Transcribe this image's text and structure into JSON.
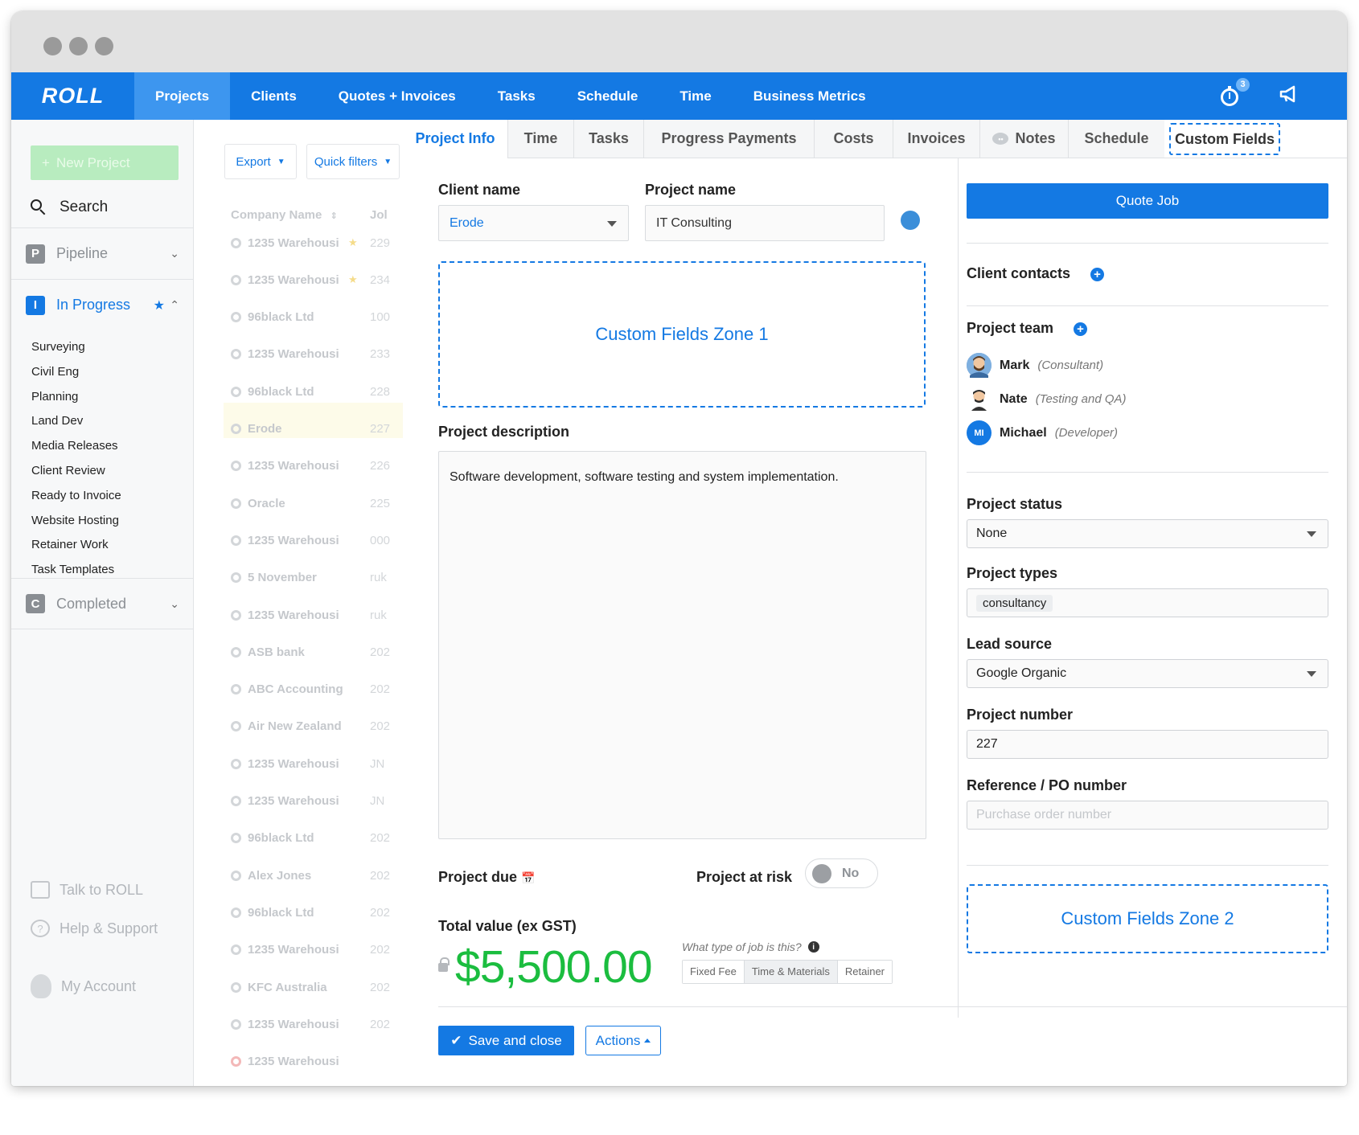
{
  "nav": {
    "logo": "ROLL",
    "items": [
      "Projects",
      "Clients",
      "Quotes + Invoices",
      "Tasks",
      "Schedule",
      "Time",
      "Business Metrics"
    ],
    "timer_badge": "3",
    "accent": "#1479e3"
  },
  "sidebar": {
    "new_project": "New Project",
    "search": "Search",
    "pipeline": {
      "letter": "P",
      "label": "Pipeline"
    },
    "in_progress": {
      "letter": "I",
      "label": "In Progress"
    },
    "sub_items": [
      "Surveying",
      "Civil Eng",
      "Planning",
      "Land Dev",
      "Media Releases",
      "Client Review",
      "Ready to Invoice",
      "Website Hosting",
      "Retainer Work",
      "Task Templates"
    ],
    "completed": {
      "letter": "C",
      "label": "Completed"
    },
    "footer": {
      "talk": "Talk to ROLL",
      "help": "Help & Support",
      "account": "My Account"
    }
  },
  "list": {
    "export": "Export",
    "quick_filters": "Quick filters",
    "col_company": "Company Name",
    "col_job": "Jol",
    "rows": [
      {
        "name": "1235 Warehousi",
        "num": "229",
        "star": true
      },
      {
        "name": "1235 Warehousi",
        "num": "234",
        "star": true
      },
      {
        "name": "96black Ltd",
        "num": "100"
      },
      {
        "name": "1235 Warehousi",
        "num": "233"
      },
      {
        "name": "96black Ltd",
        "num": "228"
      },
      {
        "name": "Erode",
        "num": "227"
      },
      {
        "name": "1235 Warehousi",
        "num": "226"
      },
      {
        "name": "Oracle",
        "num": "225"
      },
      {
        "name": "1235 Warehousi",
        "num": "000"
      },
      {
        "name": "5 November",
        "num": "ruk"
      },
      {
        "name": "1235 Warehousi",
        "num": "ruk"
      },
      {
        "name": "ASB bank",
        "num": "202"
      },
      {
        "name": "ABC Accounting",
        "num": "202"
      },
      {
        "name": "Air New Zealand",
        "num": "202"
      },
      {
        "name": "1235 Warehousi",
        "num": "JN"
      },
      {
        "name": "1235 Warehousi",
        "num": "JN"
      },
      {
        "name": "96black Ltd",
        "num": "202"
      },
      {
        "name": "Alex Jones",
        "num": "202"
      },
      {
        "name": "96black Ltd",
        "num": "202"
      },
      {
        "name": "1235 Warehousi",
        "num": "202"
      },
      {
        "name": "KFC Australia",
        "num": "202"
      },
      {
        "name": "1235 Warehousi",
        "num": "202"
      },
      {
        "name": "1235 Warehousi",
        "num": "",
        "red": true
      }
    ]
  },
  "tabs": [
    "Project Info",
    "Time",
    "Tasks",
    "Progress Payments",
    "Costs",
    "Invoices",
    "Notes",
    "Schedule",
    "Custom Fields"
  ],
  "form": {
    "client_name_label": "Client name",
    "client_name": "Erode",
    "project_name_label": "Project name",
    "project_name": "IT Consulting",
    "zone1": "Custom Fields Zone 1",
    "description_label": "Project description",
    "description": "Software development, software testing and system implementation.",
    "due_label": "Project due",
    "risk_label": "Project at risk",
    "risk_value": "No",
    "total_label": "Total value (ex GST)",
    "total": "$5,500.00",
    "job_type_q": "What type of job is this?",
    "job_types": [
      "Fixed Fee",
      "Time & Materials",
      "Retainer"
    ],
    "job_type_selected": "Time & Materials",
    "save": "Save and close",
    "actions": "Actions"
  },
  "right": {
    "quote_job": "Quote Job",
    "client_contacts": "Client contacts",
    "project_team": "Project team",
    "team": [
      {
        "name": "Mark",
        "role": "(Consultant)"
      },
      {
        "name": "Nate",
        "role": "(Testing and QA)"
      },
      {
        "name": "Michael",
        "role": "(Developer)",
        "initials": "MI"
      }
    ],
    "status_label": "Project status",
    "status": "None",
    "types_label": "Project types",
    "types": "consultancy",
    "lead_label": "Lead source",
    "lead": "Google Organic",
    "number_label": "Project number",
    "number": "227",
    "ref_label": "Reference / PO number",
    "ref_placeholder": "Purchase order number",
    "zone2": "Custom Fields Zone 2"
  }
}
